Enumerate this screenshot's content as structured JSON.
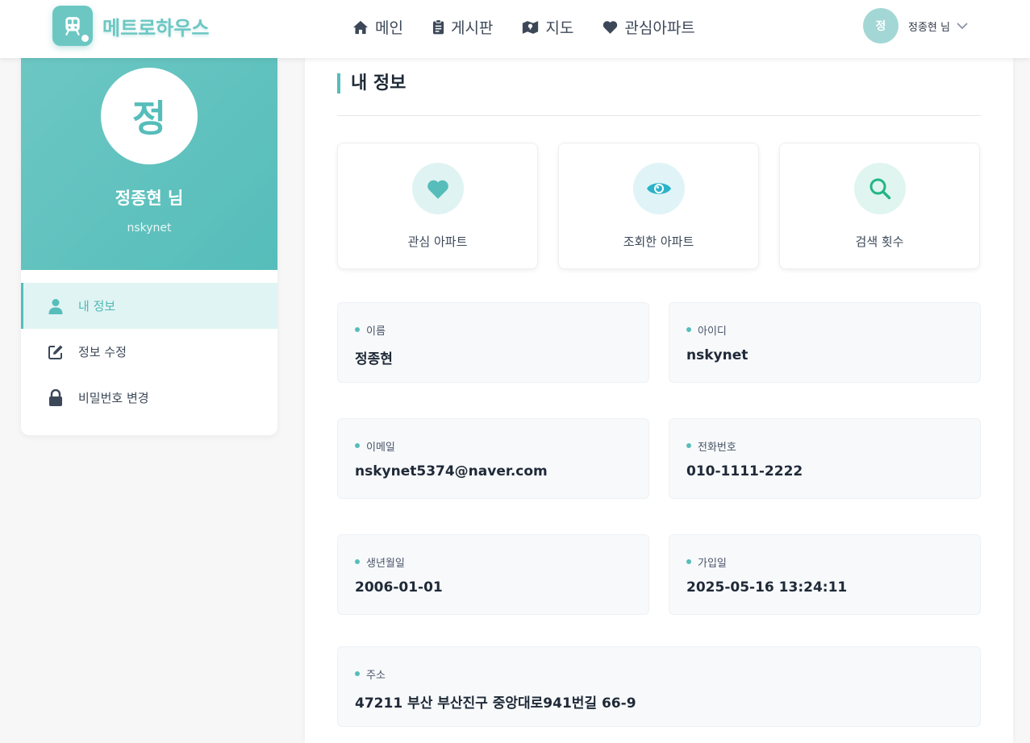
{
  "header": {
    "logo_text": "메트로하우스",
    "nav": [
      {
        "label": "메인",
        "icon": "home-icon"
      },
      {
        "label": "게시판",
        "icon": "clipboard-icon"
      },
      {
        "label": "지도",
        "icon": "map-icon"
      },
      {
        "label": "관심아파트",
        "icon": "heart-icon"
      }
    ],
    "user": {
      "avatar": "정",
      "name": "정종현 님"
    }
  },
  "sidebar": {
    "profile": {
      "avatar": "정",
      "name": "정종현 님",
      "id": "nskynet"
    },
    "menu": [
      {
        "label": "내 정보",
        "icon": "user-icon",
        "active": true
      },
      {
        "label": "정보 수정",
        "icon": "edit-icon",
        "active": false
      },
      {
        "label": "비밀번호 변경",
        "icon": "lock-icon",
        "active": false
      }
    ]
  },
  "main": {
    "title": "내 정보",
    "stats": [
      {
        "label": "관심 아파트",
        "icon": "heart-icon"
      },
      {
        "label": "조회한 아파트",
        "icon": "eye-icon"
      },
      {
        "label": "검색 횟수",
        "icon": "search-icon"
      }
    ],
    "info": {
      "name": {
        "label": "이름",
        "value": "정종현"
      },
      "id": {
        "label": "아이디",
        "value": "nskynet"
      },
      "email": {
        "label": "이메일",
        "value": "nskynet5374@naver.com"
      },
      "phone": {
        "label": "전화번호",
        "value": "010-1111-2222"
      },
      "birth": {
        "label": "생년월일",
        "value": "2006-01-01"
      },
      "joined": {
        "label": "가입일",
        "value": "2025-05-16 13:24:11"
      },
      "address": {
        "label": "주소",
        "value": "47211 부산 부산진구 중앙대로941번길 66-9"
      }
    }
  },
  "colors": {
    "accent": "#56bdba",
    "accent_light": "#e0f4f3",
    "text": "#1f2937"
  }
}
